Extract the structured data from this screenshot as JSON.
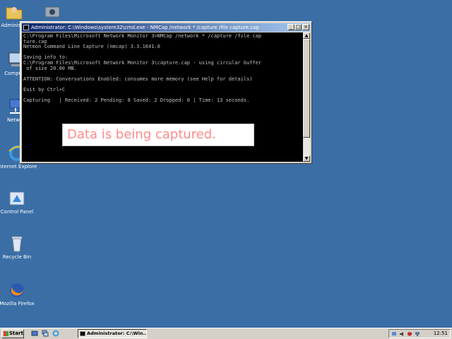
{
  "window": {
    "title": "Administrator: C:\\Windows\\system32\\cmd.exe - NMCap /network * /capture /file capture.cap",
    "controls": {
      "minimize": "_",
      "maximize": "□",
      "close": "×"
    }
  },
  "console": {
    "lines": [
      "C:\\Program Files\\Microsoft Network Monitor 3>NMCap /network * /capture /file cap",
      "ture.cap",
      "Netmon Command Line Capture (nmcap) 3.3.1641.0",
      "",
      "Saving info to:",
      "C:\\Program Files\\Microsoft Network Monitor 3\\capture.cap - using circular buffer",
      " of size 20.00 MB.",
      "",
      "ATTENTION: Conversations Enabled: consumes more memory (see Help for details)",
      "",
      "Exit by Ctrl+C",
      "",
      "Capturing   | Received: 2 Pending: 0 Saved: 2 Dropped: 0 | Time: 13 seconds."
    ]
  },
  "caption": "Data is being captured.",
  "desktop_icons": [
    {
      "label": "Administ...",
      "icon": "user-folder-icon"
    },
    {
      "label": "Compu...",
      "icon": "computer-icon"
    },
    {
      "label": "Netw...",
      "icon": "network-icon"
    },
    {
      "label": "Internet Explorer",
      "icon": "internet-explorer-icon"
    },
    {
      "label": "Control Panel",
      "icon": "control-panel-icon"
    },
    {
      "label": "Recycle Bin",
      "icon": "recycle-bin-icon"
    },
    {
      "label": "Mozilla Firefox",
      "icon": "firefox-icon"
    }
  ],
  "taskbar": {
    "start_label": "Start",
    "task_label": "Administrator: C:\\Win...",
    "clock": "12:51"
  },
  "colors": {
    "desktop": "#3a6ea5",
    "caption_text": "#ff8a8a",
    "title_gradient_start": "#0a246a"
  }
}
